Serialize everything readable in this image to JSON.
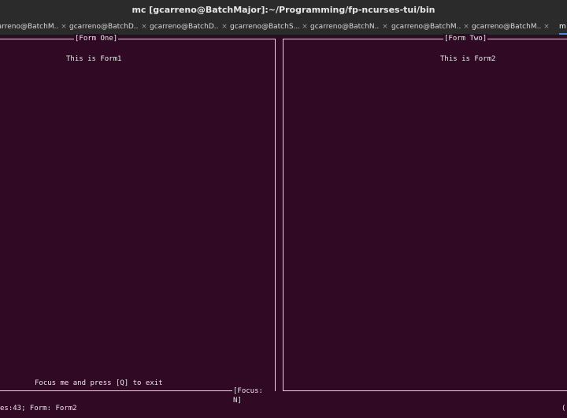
{
  "window": {
    "title": "mc [gcarreno@BatchMajor]:~/Programming/fp-ncurses-tui/bin"
  },
  "tabs": [
    {
      "label": "gcarreno@BatchM...",
      "close": "×"
    },
    {
      "label": "gcarreno@BatchD...",
      "close": "×"
    },
    {
      "label": "gcarreno@BatchD...",
      "close": "×"
    },
    {
      "label": "gcarreno@BatchS...",
      "close": "×"
    },
    {
      "label": "gcarreno@BatchN...",
      "close": "×"
    },
    {
      "label": "gcarreno@BatchM...",
      "close": "×"
    },
    {
      "label": "gcarreno@BatchM...",
      "close": "×"
    },
    {
      "label": "m",
      "close": ""
    }
  ],
  "form_one": {
    "title": "[Form One]",
    "body_text": "This is Form1",
    "prompt": "Focus me and press [Q] to exit",
    "focus_label": "[Focus: N]"
  },
  "form_two": {
    "title": "[Form Two]",
    "body_text": "This is Form2"
  },
  "status": {
    "left": "es:43; Form: Form2",
    "right": "("
  }
}
